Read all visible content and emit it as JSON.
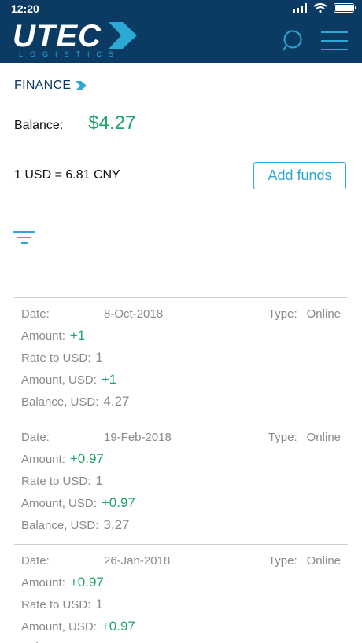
{
  "status": {
    "time": "12:20"
  },
  "header": {
    "logo_text": "UTEC",
    "logo_sub": "LOGISTICS",
    "search_icon": "search-icon",
    "menu_icon": "hamburger-menu-icon"
  },
  "breadcrumb": {
    "label": "FINANCE"
  },
  "balance": {
    "label": "Balance:",
    "value": "$4.27"
  },
  "rate": {
    "text": "1 USD = 6.81 CNY"
  },
  "add_funds": {
    "label": "Add funds"
  },
  "labels": {
    "date": "Date:",
    "type": "Type:",
    "amount": "Amount:",
    "rate_to_usd": "Rate to USD:",
    "amount_usd": "Amount, USD:",
    "balance_usd": "Balance, USD:"
  },
  "transactions": [
    {
      "date": "8-Oct-2018",
      "type": "Online",
      "amount": "+1",
      "rate_to_usd": "1",
      "amount_usd": "+1",
      "balance_usd": "4.27"
    },
    {
      "date": "19-Feb-2018",
      "type": "Online",
      "amount": "+0.97",
      "rate_to_usd": "1",
      "amount_usd": "+0.97",
      "balance_usd": "3.27"
    },
    {
      "date": "26-Jan-2018",
      "type": "Online",
      "amount": "+0.97",
      "rate_to_usd": "1",
      "amount_usd": "+0.97",
      "balance_usd": ""
    }
  ],
  "colors": {
    "header_bg": "#0b3a63",
    "accent": "#2aa8d6",
    "positive": "#1fa56b",
    "muted": "#8a8a8a"
  }
}
